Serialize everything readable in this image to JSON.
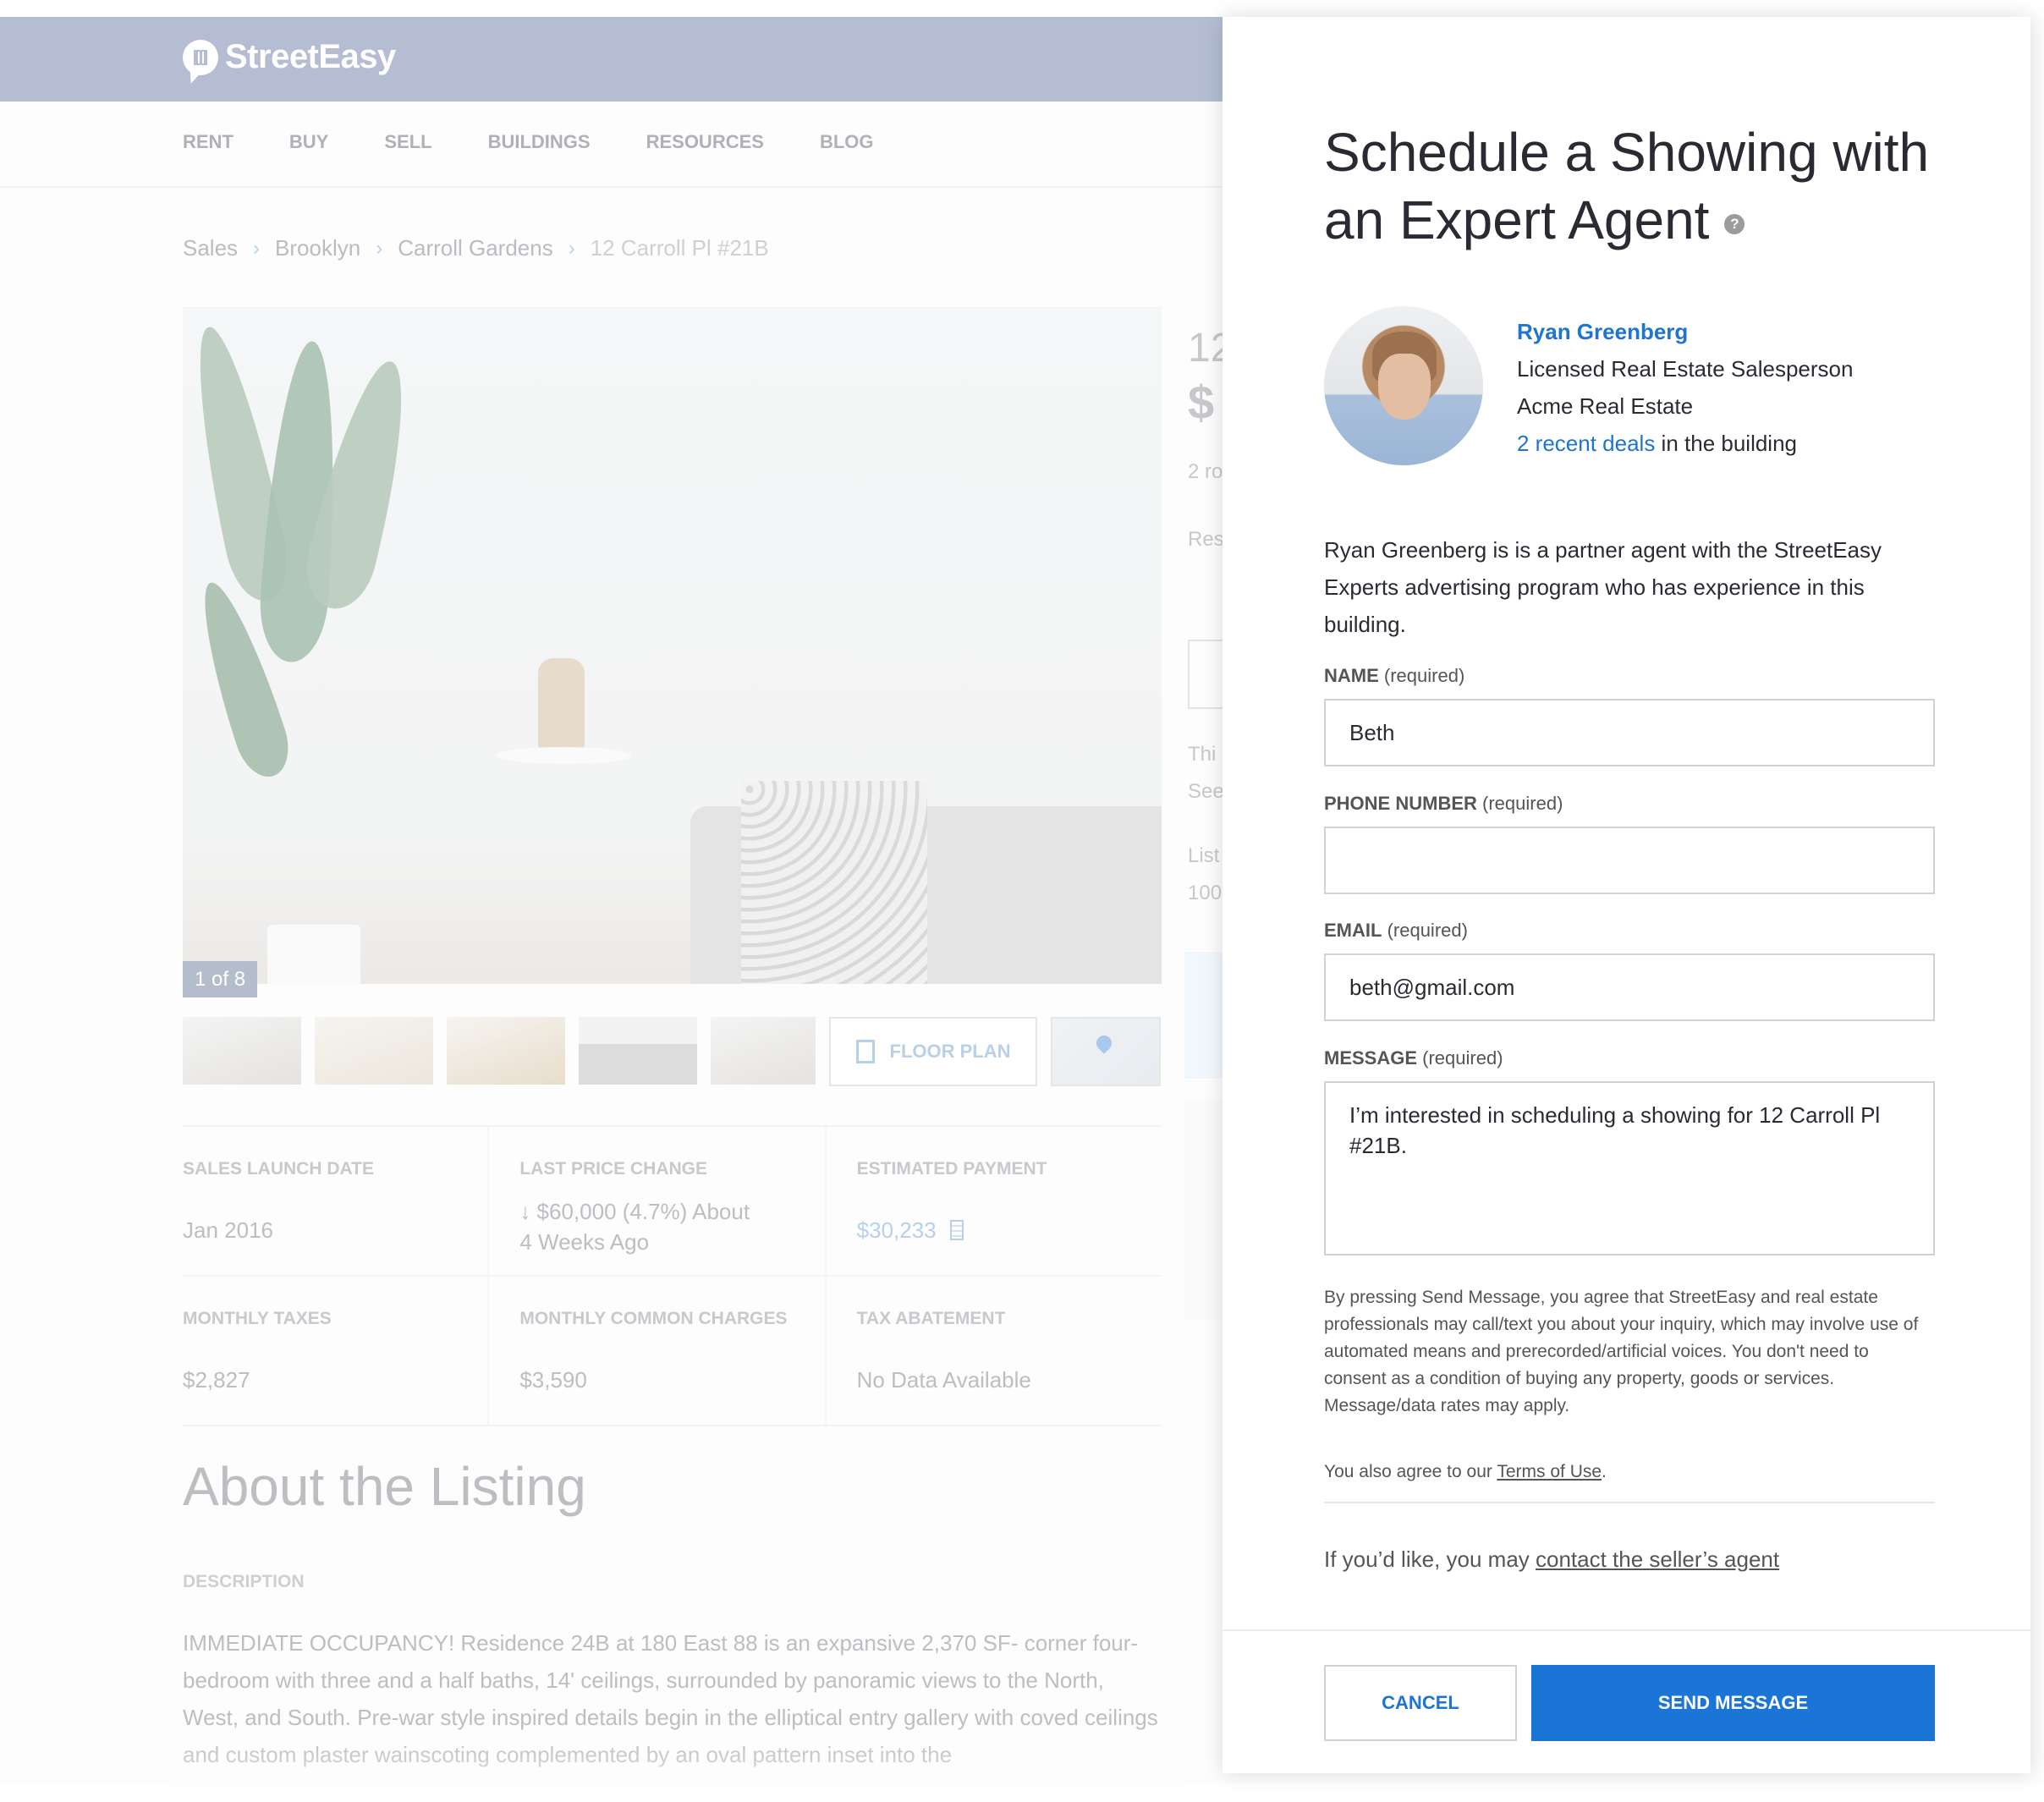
{
  "header": {
    "logo_text": "StreetEasy",
    "nav": [
      "RENT",
      "BUY",
      "SELL",
      "BUILDINGS",
      "RESOURCES",
      "BLOG"
    ]
  },
  "breadcrumb": [
    "Sales",
    "Brooklyn",
    "Carroll Gardens",
    "12 Carroll Pl #21B"
  ],
  "gallery": {
    "counter": "1 of 8",
    "floor_plan_label": "FLOOR PLAN"
  },
  "side_peek": [
    "12",
    "$",
    "2 ro",
    "Res",
    "Thi",
    "See",
    "List",
    "100"
  ],
  "facts": [
    {
      "label": "SALES LAUNCH DATE",
      "value": "Jan 2016"
    },
    {
      "label": "LAST PRICE CHANGE",
      "value": "↓ $60,000 (4.7%) About 4 Weeks Ago"
    },
    {
      "label": "ESTIMATED PAYMENT",
      "value": "$30,233"
    },
    {
      "label": "MONTHLY TAXES",
      "value": "$2,827"
    },
    {
      "label": "MONTHLY COMMON CHARGES",
      "value": "$3,590"
    },
    {
      "label": "TAX ABATEMENT",
      "value": "No Data Available"
    }
  ],
  "about": {
    "title": "About the Listing",
    "description_label": "DESCRIPTION",
    "description": "IMMEDIATE OCCUPANCY! Residence 24B at 180 East 88 is an expansive 2,370 SF- corner four-bedroom with three and a half baths, 14' ceilings, surrounded by panoramic views to the North, West, and South. Pre-war style inspired details begin in the elliptical entry gallery with coved ceilings and custom plaster wainscoting complemented by an oval pattern inset into the"
  },
  "modal": {
    "title": "Schedule a Showing with an Expert Agent",
    "help_icon": "?",
    "agent": {
      "name": "Ryan Greenberg",
      "title": "Licensed Real Estate Salesperson",
      "company": "Acme Real Estate",
      "deals_link": "2 recent deals",
      "deals_suffix": " in the building"
    },
    "bio": "Ryan Greenberg is is a partner agent with the StreetEasy Experts advertising program who has experience in this building.",
    "fields": {
      "name": {
        "label": "NAME",
        "hint": "(required)",
        "value": "Beth"
      },
      "phone": {
        "label": "PHONE NUMBER",
        "hint": "(required)",
        "value": ""
      },
      "email": {
        "label": "EMAIL",
        "hint": "(required)",
        "value": "beth@gmail.com"
      },
      "message": {
        "label": "MESSAGE",
        "hint": "(required)",
        "value": "I’m interested in scheduling a showing for 12 Carroll Pl #21B."
      }
    },
    "consent": "By pressing Send Message, you agree that StreetEasy and real estate professionals may call/text you about your inquiry, which may involve use of automated means and prerecorded/artificial voices. You don't need to consent as a condition of buying any property, goods or services. Message/data rates may apply.",
    "terms_prefix": "You also agree to our ",
    "terms_link": "Terms of Use",
    "terms_suffix": ".",
    "contact_prefix": "If you’d like, you may ",
    "contact_link": "contact the seller’s agent",
    "cancel_label": "CANCEL",
    "send_label": "SEND MESSAGE"
  },
  "colors": {
    "accent": "#1a75d6",
    "header_overlay": "#b4bdd2"
  }
}
